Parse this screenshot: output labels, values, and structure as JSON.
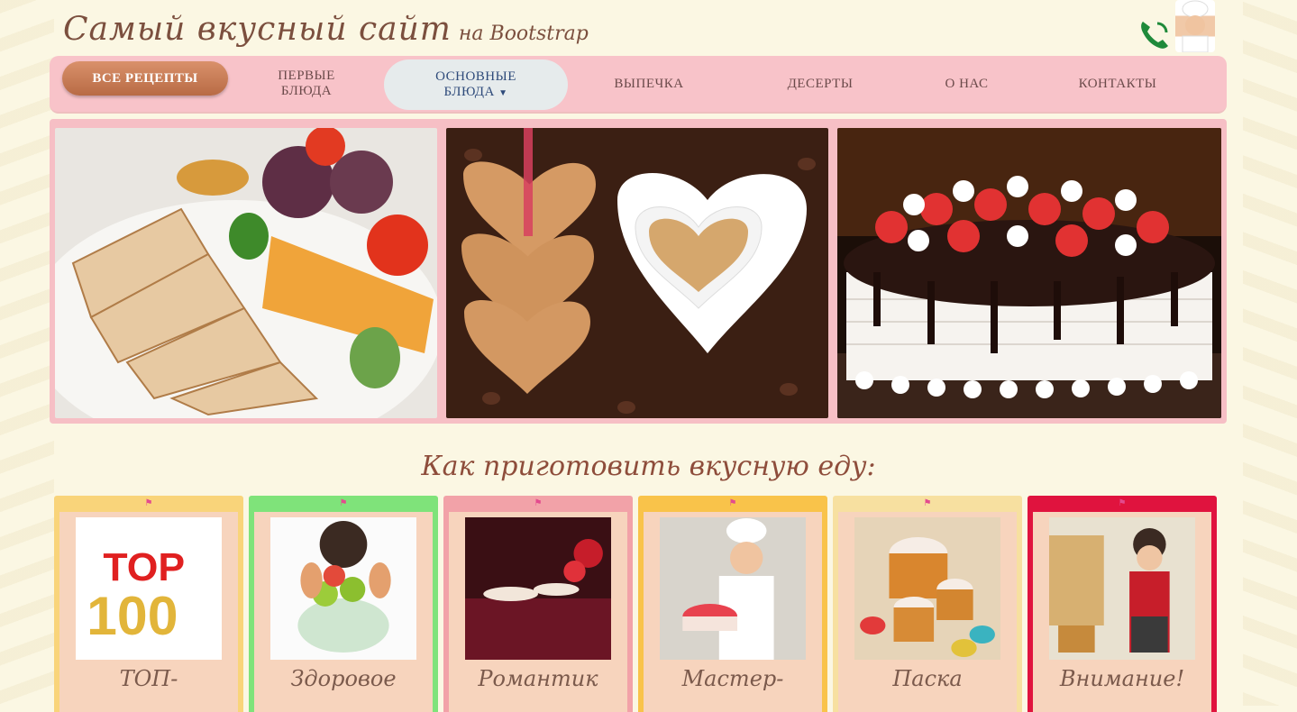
{
  "brand": {
    "title": "Самый вкусный сайт",
    "subtitle": "на Bootstrap"
  },
  "nav": {
    "items": [
      {
        "label": "ВСЕ РЕЦЕПТЫ"
      },
      {
        "label": "ПЕРВЫЕ БЛЮДА"
      },
      {
        "label": "ОСНОВНЫЕ БЛЮДА"
      },
      {
        "label": "ВЫПЕЧКА"
      },
      {
        "label": "ДЕСЕРТЫ"
      },
      {
        "label": "О НАС"
      },
      {
        "label": "КОНТАКТЫ"
      }
    ]
  },
  "slider": {
    "slides": [
      {
        "icon": "grilled-chicken-photo"
      },
      {
        "icon": "heart-cookies-coffee-photo"
      },
      {
        "icon": "strawberry-cake-photo"
      }
    ]
  },
  "section": {
    "title": "Как приготовить вкусную еду:"
  },
  "cards": [
    {
      "caption": "ТОП-",
      "color": "#f9d47a",
      "icon": "top-100-image"
    },
    {
      "caption": "Здоровое",
      "color": "#7fe37a",
      "icon": "healthy-fruit-image"
    },
    {
      "caption": "Романтик",
      "color": "#f2a2a8",
      "icon": "romantic-dinner-image"
    },
    {
      "caption": "Мастер-",
      "color": "#f9c34a",
      "icon": "chef-cake-image"
    },
    {
      "caption": "Паска",
      "color": "#f7e0a0",
      "icon": "easter-cake-image"
    },
    {
      "caption": "Внимание!",
      "color": "#e0133e",
      "icon": "retro-woman-kitchen-image"
    }
  ],
  "colors": {
    "navbar": "#f8c3c9",
    "accent": "#c07650",
    "background": "#fbf7e3"
  }
}
